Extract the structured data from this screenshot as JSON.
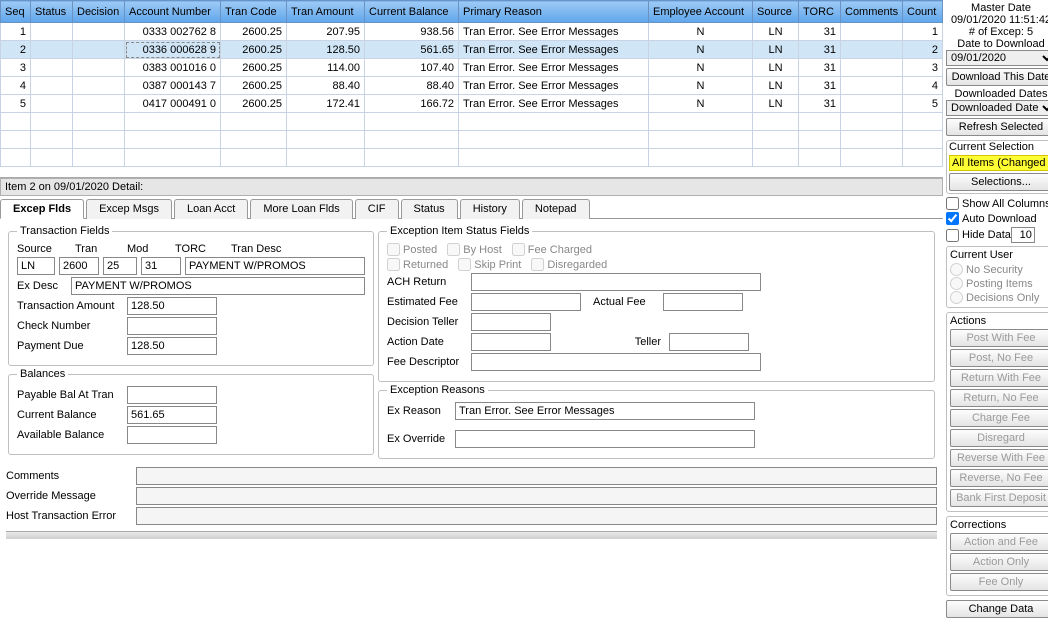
{
  "grid": {
    "headers": [
      "Seq",
      "Status",
      "Decision",
      "Account Number",
      "Tran Code",
      "Tran Amount",
      "Current Balance",
      "Primary Reason",
      "Employee Account",
      "Source",
      "TORC",
      "Comments",
      "Count",
      ""
    ],
    "rows": [
      {
        "seq": "1",
        "status": "",
        "decision": "",
        "acct": "0333 002762 8",
        "tcode": "2600.25",
        "tamt": "207.95",
        "cbal": "938.56",
        "reason": "Tran Error. See Error Messages",
        "emp": "N",
        "src": "LN",
        "torc": "31",
        "comments": "",
        "count": "1"
      },
      {
        "seq": "2",
        "status": "",
        "decision": "",
        "acct": "0336 000628 9",
        "tcode": "2600.25",
        "tamt": "128.50",
        "cbal": "561.65",
        "reason": "Tran Error. See Error Messages",
        "emp": "N",
        "src": "LN",
        "torc": "31",
        "comments": "",
        "count": "2",
        "selected": true
      },
      {
        "seq": "3",
        "status": "",
        "decision": "",
        "acct": "0383 001016 0",
        "tcode": "2600.25",
        "tamt": "114.00",
        "cbal": "107.40",
        "reason": "Tran Error. See Error Messages",
        "emp": "N",
        "src": "LN",
        "torc": "31",
        "comments": "",
        "count": "3"
      },
      {
        "seq": "4",
        "status": "",
        "decision": "",
        "acct": "0387 000143 7",
        "tcode": "2600.25",
        "tamt": "88.40",
        "cbal": "88.40",
        "reason": "Tran Error. See Error Messages",
        "emp": "N",
        "src": "LN",
        "torc": "31",
        "comments": "",
        "count": "4"
      },
      {
        "seq": "5",
        "status": "",
        "decision": "",
        "acct": "0417 000491 0",
        "tcode": "2600.25",
        "tamt": "172.41",
        "cbal": "166.72",
        "reason": "Tran Error. See Error Messages",
        "emp": "N",
        "src": "LN",
        "torc": "31",
        "comments": "",
        "count": "5"
      }
    ]
  },
  "detail_bar": "Item 2 on 09/01/2020 Detail:",
  "tabs": [
    "Excep Flds",
    "Excep Msgs",
    "Loan Acct",
    "More Loan Flds",
    "CIF",
    "Status",
    "History",
    "Notepad"
  ],
  "tf": {
    "legend": "Transaction Fields",
    "hdr_source": "Source",
    "hdr_tran": "Tran",
    "hdr_mod": "Mod",
    "hdr_torc": "TORC",
    "hdr_desc": "Tran Desc",
    "source": "LN",
    "tran": "2600",
    "mod": "25",
    "torc": "31",
    "tdesc": "PAYMENT W/PROMOS",
    "lbl_exdesc": "Ex Desc",
    "exdesc": "PAYMENT W/PROMOS",
    "lbl_tamt": "Transaction Amount",
    "tamt": "128.50",
    "lbl_chk": "Check Number",
    "chk": "",
    "lbl_pdue": "Payment Due",
    "pdue": "128.50"
  },
  "bal": {
    "legend": "Balances",
    "lbl_pbat": "Payable Bal At Tran",
    "pbat": "",
    "lbl_cb": "Current Balance",
    "cb": "561.65",
    "lbl_ab": "Available Balance",
    "ab": ""
  },
  "eisf": {
    "legend": "Exception Item Status Fields",
    "posted": "Posted",
    "byhost": "By Host",
    "fee": "Fee Charged",
    "returned": "Returned",
    "skip": "Skip Print",
    "disreg": "Disregarded",
    "lbl_ach": "ACH Return",
    "ach": "",
    "lbl_estfee": "Estimated Fee",
    "estfee": "",
    "lbl_actfee": "Actual Fee",
    "actfee": "",
    "lbl_dteller": "Decision Teller",
    "dteller": "",
    "lbl_adate": "Action Date",
    "adate": "",
    "lbl_teller": "Teller",
    "teller": "",
    "lbl_feed": "Fee Descriptor",
    "feed": ""
  },
  "er": {
    "legend": "Exception Reasons",
    "lbl_reason": "Ex Reason",
    "reason": "Tran Error. See Error Messages",
    "lbl_override": "Ex Override",
    "override": ""
  },
  "bottom": {
    "lbl_comments": "Comments",
    "comments": "",
    "lbl_override": "Override Message",
    "override": "",
    "lbl_hte": "Host Transaction Error",
    "hte": ""
  },
  "side": {
    "master_date_lbl": "Master Date",
    "master_date": "09/01/2020  11:51:42",
    "excep_lbl": "# of Excep: 5",
    "date_dl_lbl": "Date to Download",
    "date_dl": "09/01/2020",
    "btn_dl": "Download This Date",
    "dd_lbl": "Downloaded Dates",
    "dd_sel": "Downloaded Dates",
    "btn_refresh": "Refresh Selected",
    "cursel_lbl": "Current Selection",
    "cursel_val": "All Items (Changed Sel",
    "btn_selections": "Selections...",
    "chk_showall": "Show All Columns",
    "chk_autodl": "Auto Download",
    "chk_hide": "Hide Data",
    "hide_num": "10",
    "curuser_lbl": "Current User",
    "r1": "No Security",
    "r2": "Posting Items",
    "r3": "Decisions Only",
    "actions_lbl": "Actions",
    "a1": "Post With Fee",
    "a2": "Post, No Fee",
    "a3": "Return With Fee",
    "a4": "Return, No Fee",
    "a5": "Charge Fee",
    "a6": "Disregard",
    "a7": "Reverse With Fee",
    "a8": "Reverse, No Fee",
    "a9": "Bank First Deposit",
    "corr_lbl": "Corrections",
    "c1": "Action and Fee",
    "c2": "Action Only",
    "c3": "Fee Only",
    "btn_change": "Change Data"
  }
}
